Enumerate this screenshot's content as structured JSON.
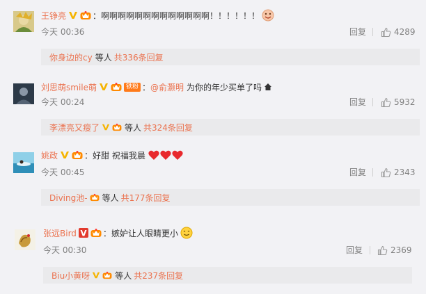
{
  "comments": [
    {
      "username": "王铮亮",
      "text": "啊啊啊啊啊啊啊啊啊啊啊啊啊！！！！！！",
      "time": "今天 00:36",
      "reply_label": "回复",
      "likes": "4289",
      "sub": {
        "user": "你身边的cy",
        "mid": "等人",
        "count": "共336条回复"
      }
    },
    {
      "username": "刘思萌smile萌",
      "fan_badge": "铁粉",
      "mention": "@俞灏明",
      "text": "为你的年少买单了吗",
      "time": "今天 00:24",
      "reply_label": "回复",
      "likes": "5932",
      "sub": {
        "user": "李漂亮又瘦了",
        "mid": "等人",
        "count": "共324条回复"
      }
    },
    {
      "username": "姚政",
      "text": "好甜 祝福我晨",
      "time": "今天 00:45",
      "reply_label": "回复",
      "likes": "2343",
      "sub": {
        "user": "Diving池-",
        "mid": "等人",
        "count": "共177条回复"
      }
    },
    {
      "username": "张远Bird",
      "text": "嫉妒让人眼睛更小",
      "time": "今天 00:30",
      "reply_label": "回复",
      "likes": "2369",
      "sub": {
        "user": "Biu小黄呀",
        "mid": "等人",
        "count": "共237条回复"
      }
    }
  ],
  "icons": {
    "verified": "verified-v-icon",
    "member": "member-crown-icon",
    "like": "thumbs-up-icon",
    "emoji": "emoji-icon",
    "heart": "red-heart-icon",
    "house": "house-icon"
  },
  "colors": {
    "username": "#eb7350",
    "text": "#333333",
    "meta": "#808080",
    "verified": "#f5b400",
    "background": "#f2f2f5",
    "sub_box": "#eaeaec"
  }
}
